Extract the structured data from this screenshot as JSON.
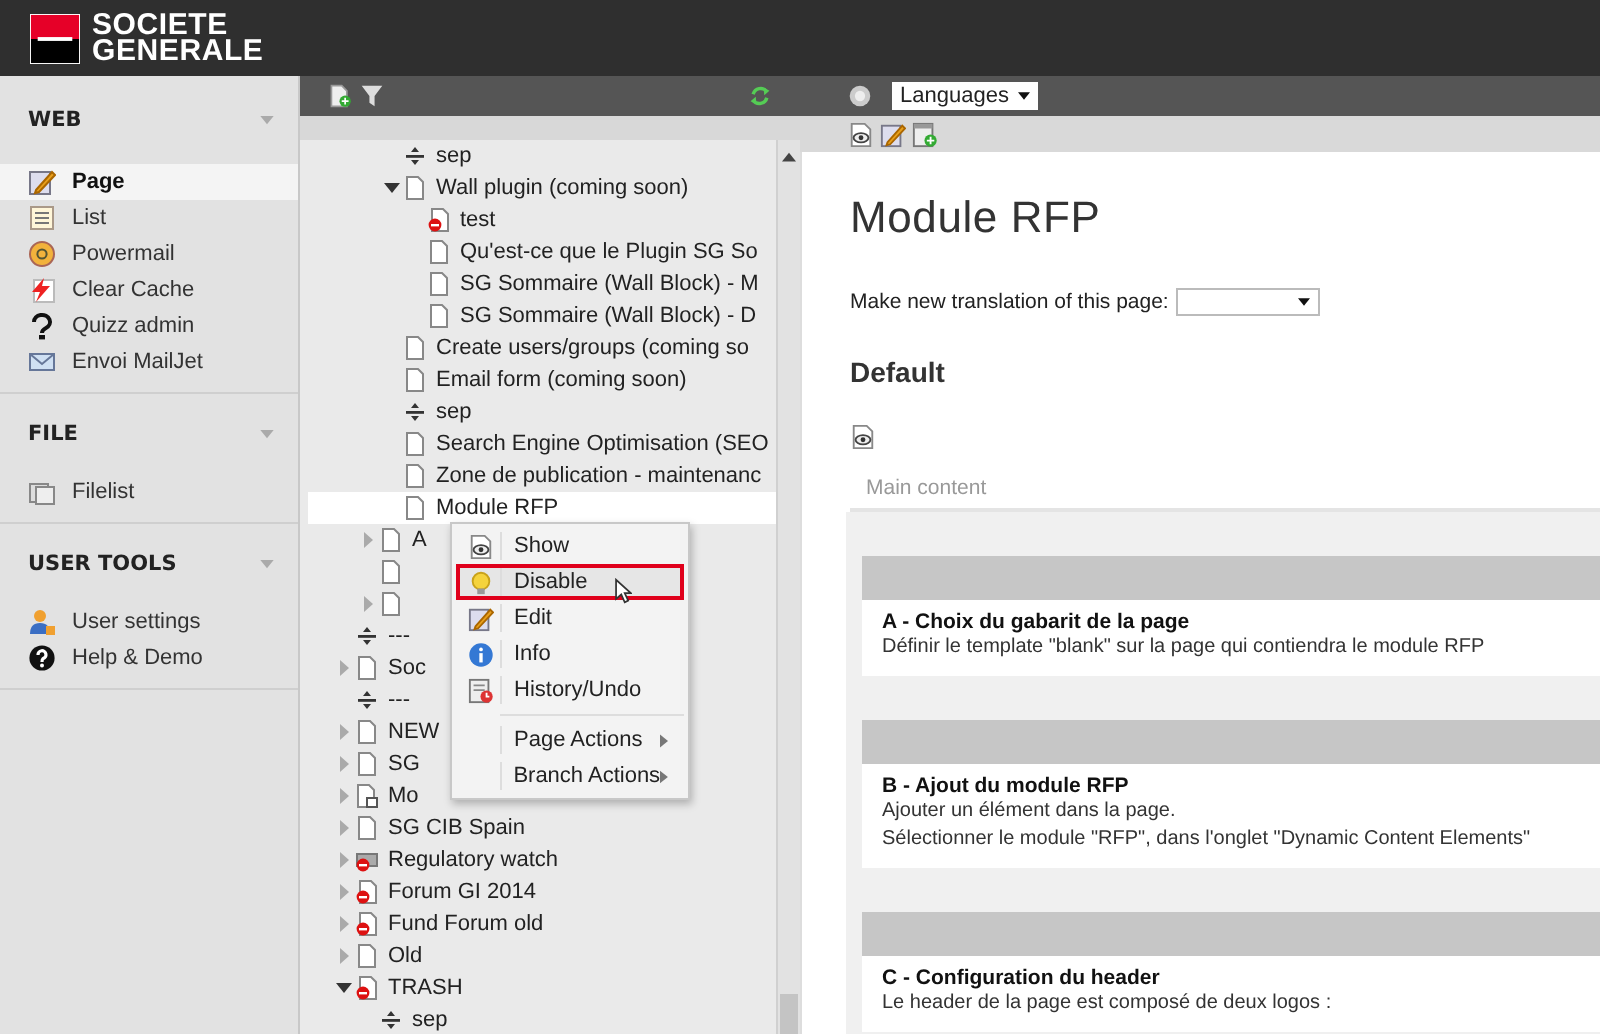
{
  "brand": {
    "line_1": "SOCIETE",
    "line_2": "GENERALE"
  },
  "modules": [
    {
      "title": "WEB",
      "expanded": true,
      "items": [
        {
          "label": "Page",
          "selected": true
        },
        {
          "label": "List",
          "selected": false
        },
        {
          "label": "Powermail",
          "selected": false
        },
        {
          "label": "Clear Cache",
          "selected": false
        },
        {
          "label": "Quizz admin",
          "selected": false
        },
        {
          "label": "Envoi MailJet",
          "selected": false
        }
      ]
    },
    {
      "title": "FILE",
      "expanded": true,
      "items": [
        {
          "label": "Filelist",
          "selected": false
        }
      ]
    },
    {
      "title": "USER TOOLS",
      "expanded": true,
      "items": [
        {
          "label": "User settings",
          "selected": false
        },
        {
          "label": "Help & Demo",
          "selected": false
        }
      ]
    }
  ],
  "tree": [
    {
      "children": [
        {
          "children": [
            {
              "kind": "sep",
              "label": "sep",
              "selected": false
            },
            {
              "kind": "page",
              "label": "Wall plugin (coming soon)",
              "expanded": true,
              "selected": false,
              "children": [
                {
                  "kind": "hidden-page",
                  "label": "test",
                  "selected": false
                },
                {
                  "kind": "page",
                  "label": "Qu'est-ce que le Plugin SG So",
                  "selected": false
                },
                {
                  "kind": "page",
                  "label": "SG Sommaire (Wall Block) - M",
                  "selected": false
                },
                {
                  "kind": "page",
                  "label": "SG Sommaire (Wall Block) - D",
                  "selected": false
                }
              ]
            },
            {
              "kind": "page",
              "label": "Create users/groups (coming so",
              "selected": false
            },
            {
              "kind": "page",
              "label": "Email form (coming soon)",
              "selected": false
            },
            {
              "kind": "sep",
              "label": "sep",
              "selected": false
            },
            {
              "kind": "page",
              "label": "Search Engine Optimisation (SEO",
              "selected": false
            },
            {
              "kind": "page",
              "label": "Zone de publication - maintenanc",
              "selected": false
            },
            {
              "kind": "page",
              "label": "Module RFP",
              "selected": true
            }
          ]
        },
        {
          "kind": "page",
          "label": "A",
          "expanded": false,
          "selected": false
        },
        {
          "kind": "page",
          "selected": false
        },
        {
          "kind": "page",
          "expanded": false,
          "selected": false
        }
      ]
    },
    {
      "kind": "sep",
      "label": "---",
      "selected": false
    },
    {
      "kind": "page",
      "label": "Soc",
      "expanded": false,
      "selected": false
    },
    {
      "kind": "sep",
      "label": "---",
      "selected": false
    },
    {
      "kind": "page",
      "label": "NEW",
      "expanded": false,
      "selected": false
    },
    {
      "kind": "page",
      "label": "SG",
      "expanded": false,
      "selected": false
    },
    {
      "kind": "mount-page",
      "label": "Mo",
      "expanded": false,
      "selected": false
    },
    {
      "kind": "page",
      "label": "SG CIB Spain",
      "expanded": false,
      "selected": false
    },
    {
      "kind": "hidden-folder",
      "label": "Regulatory watch",
      "expanded": false,
      "selected": false
    },
    {
      "kind": "hidden-page",
      "label": "Forum GI 2014",
      "expanded": false,
      "selected": false
    },
    {
      "kind": "hidden-page",
      "label": "Fund Forum old",
      "expanded": false,
      "selected": false
    },
    {
      "kind": "page",
      "label": "Old",
      "expanded": false,
      "selected": false
    },
    {
      "kind": "hidden-page",
      "label": "TRASH",
      "expanded": true,
      "selected": false,
      "children": [
        {
          "kind": "sep",
          "label": "sep",
          "selected": false
        }
      ]
    }
  ],
  "context_menu": [
    {
      "kind": "action",
      "label": "Show",
      "highlighted": false
    },
    {
      "kind": "action",
      "label": "Disable",
      "highlighted": true
    },
    {
      "kind": "action",
      "label": "Edit",
      "highlighted": false
    },
    {
      "kind": "action",
      "label": "Info",
      "highlighted": false
    },
    {
      "kind": "action",
      "label": "History/Undo",
      "highlighted": false
    },
    {
      "kind": "divider"
    },
    {
      "kind": "submenu",
      "label": "Page Actions",
      "highlighted": false
    },
    {
      "kind": "submenu",
      "label": "Branch Actions",
      "highlighted": false
    }
  ],
  "doc_header": {
    "languages": "Languages"
  },
  "page": {
    "title": "Module RFP",
    "translation_label": "Make new translation of this page:",
    "section": "Default",
    "column": "Main content",
    "blocks": [
      {
        "title": "A - Choix du gabarit de la page",
        "lines": [
          "Définir le template \"blank\" sur la page qui contiendra le module RFP"
        ]
      },
      {
        "title": "B - Ajout du module RFP",
        "lines": [
          "Ajouter un élément dans la page.",
          "Sélectionner le module \"RFP\", dans l'onglet \"Dynamic Content Elements\""
        ]
      },
      {
        "title": "C - Configuration du header",
        "lines": [
          "Le header de la page est composé de deux logos :"
        ]
      }
    ]
  }
}
